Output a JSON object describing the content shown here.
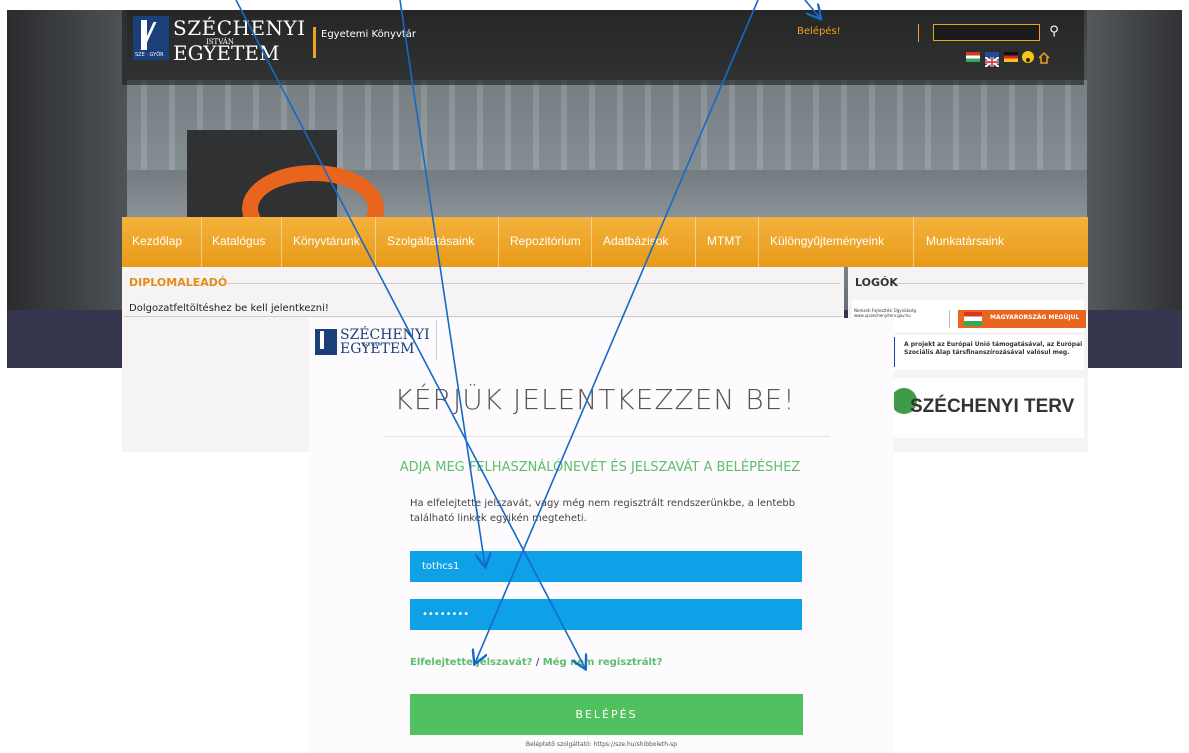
{
  "header": {
    "logo_line1": "SZÉCHENYI",
    "logo_line2": "ISTVÁN",
    "logo_line3": "EGYETEM",
    "logo_tag": "SZE · GYŐR",
    "subtitle": "Egyetemi Könyvtár",
    "login_link": "Belépés!",
    "search_placeholder": "",
    "search_icon": "search-icon",
    "flags": [
      "flag-hu-icon",
      "flag-uk-icon",
      "flag-de-icon",
      "accessibility-icon",
      "home-icon"
    ]
  },
  "nav": {
    "items": [
      "Kezdőlap",
      "Katalógus",
      "Könyvtárunk",
      "Szolgáltatásaink",
      "Repozitórium",
      "Adatbázisok",
      "MTMT",
      "Különgyűjteményeink",
      "Munkatársaink"
    ]
  },
  "left_panel": {
    "title": "DIPLOMALEADÓ",
    "notice": "Dolgozatfeltöltéshez be kell jelentkezni!"
  },
  "right_panel": {
    "title": "LOGÓK",
    "ad1_text": "Nemzeti Fejlesztési Ügynökség\nwww.ujszechenyiterv.gov.hu\n06 40 638 638",
    "ad1_banner": "MAGYARORSZÁG MEGÚJUL",
    "ad2_text": "A projekt az Európai Unió támogatásával, az Európai Szociális Alap társfinanszírozásával valósul meg.",
    "ad3_text": "SZÉCHENYI TERV"
  },
  "modal": {
    "logo_line1": "SZÉCHENYI",
    "logo_line2": "ISTVÁN",
    "logo_line3": "EGYETEM",
    "title": "KÉRJÜK JELENTKEZZEN BE!",
    "subtitle": "ADJA MEG FELHASZNÁLÓNEVÉT ÉS JELSZAVÁT A BELÉPÉSHEZ",
    "description": "Ha elfelejtette jelszavát, vagy még nem regisztrált rendszerünkbe, a lentebb található linkek egyikén megteheti.",
    "username_value": "tothcs1",
    "password_value": "••••••••",
    "forgot_link": "Elfelejtette jelszavát?",
    "link_separator": "/",
    "register_link": "Még nem regisztrált?",
    "login_button": "BELÉPÉS",
    "footer": "Beléptető szolgáltató: https://sze.hu/shibboleth-sp"
  },
  "colors": {
    "accent_orange": "#f0a21d",
    "nav_orange": "#e89a18",
    "input_blue": "#0ea1e8",
    "button_green": "#51c15f",
    "arrow_blue": "#1769c9"
  }
}
